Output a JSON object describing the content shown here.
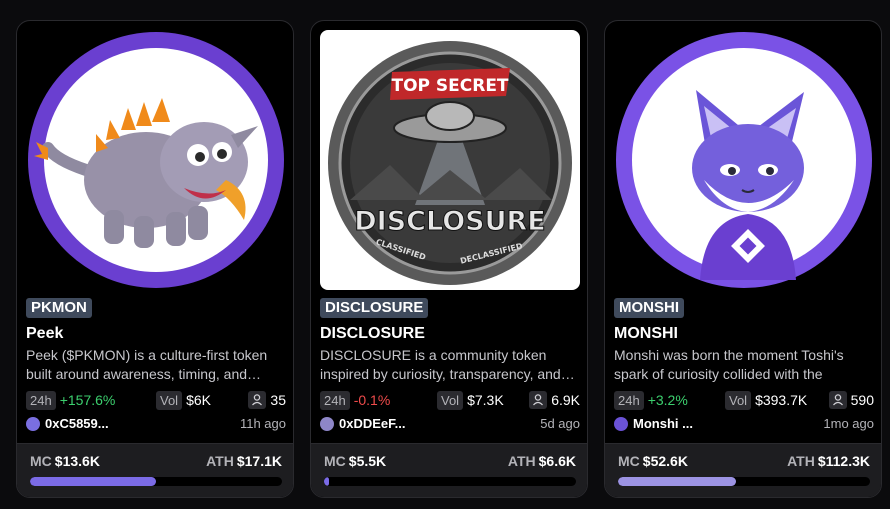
{
  "cards": [
    {
      "ticker": "PKMON",
      "title": "Peek",
      "description": "Peek ($PKMON) is a culture-first token built around awareness, timing, and…",
      "change_label": "24h",
      "change": "+157.6%",
      "change_positive": true,
      "vol_label": "Vol",
      "vol": "$6K",
      "holders": "35",
      "creator": "0xC5859...",
      "age": "11h ago",
      "mc_label": "MC",
      "mc": "$13.6K",
      "ath_label": "ATH",
      "ath": "$17.1K",
      "progress": 0.5,
      "bar_color": "#7b6be6",
      "image_icon": "dinosaur-mascot"
    },
    {
      "ticker": "DISCLOSURE",
      "title": "DISCLOSURE",
      "description": "DISCLOSURE is a community token inspired by curiosity, transparency, and…",
      "change_label": "24h",
      "change": "-0.1%",
      "change_positive": false,
      "vol_label": "Vol",
      "vol": "$7.3K",
      "holders": "6.9K",
      "creator": "0xDDEeF...",
      "age": "5d ago",
      "mc_label": "MC",
      "mc": "$5.5K",
      "ath_label": "ATH",
      "ath": "$6.6K",
      "progress": 0.02,
      "bar_color": "#7b6be6",
      "image_icon": "ufo-coin",
      "image_text_top": "TOP SECRET",
      "image_text_main": "DISCLOSURE",
      "image_text_left": "CLASSIFIED",
      "image_text_right": "DECLASSIFIED"
    },
    {
      "ticker": "MONSHI",
      "title": "MONSHI",
      "description": "Monshi was born the moment Toshi's spark of curiosity collided with the ultra-…",
      "change_label": "24h",
      "change": "+3.2%",
      "change_positive": true,
      "vol_label": "Vol",
      "vol": "$393.7K",
      "holders": "590",
      "creator": "Monshi ...",
      "age": "1mo ago",
      "mc_label": "MC",
      "mc": "$52.6K",
      "ath_label": "ATH",
      "ath": "$112.3K",
      "progress": 0.47,
      "bar_color": "#9c93e3",
      "image_icon": "cat-mascot"
    }
  ]
}
